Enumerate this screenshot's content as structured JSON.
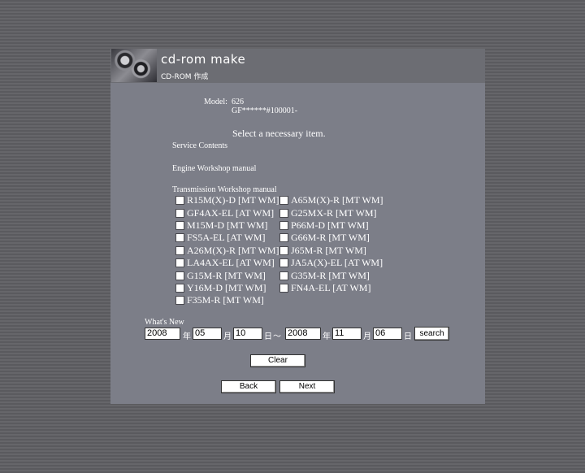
{
  "header": {
    "title": "cd-rom make",
    "subtitle": "CD-ROM 作成"
  },
  "model": {
    "label": "Model:",
    "value": "626",
    "range": "GF******#100001-"
  },
  "instruction": "Select a necessary item.",
  "sections": {
    "service": "Service Contents",
    "engine": "Engine Workshop manual",
    "transmission": "Transmission Workshop manual"
  },
  "items": [
    "R15M(X)-D [MT WM]",
    "A65M(X)-R [MT WM]",
    "GF4AX-EL [AT WM]",
    "G25MX-R [MT WM]",
    "M15M-D [MT WM]",
    "P66M-D [MT WM]",
    "FS5A-EL [AT WM]",
    "G66M-R [MT WM]",
    "A26M(X)-R [MT WM]",
    "J65M-R [MT WM]",
    "LA4AX-EL [AT WM]",
    "JA5A(X)-EL [AT WM]",
    "G15M-R [MT WM]",
    "G35M-R [MT WM]",
    "Y16M-D [MT WM]",
    "FN4A-EL [AT WM]",
    "F35M-R [MT WM]"
  ],
  "whats_new": {
    "label": "What's New",
    "from": {
      "year": "2008",
      "month": "05",
      "day": "10"
    },
    "to": {
      "year": "2008",
      "month": "11",
      "day": "06"
    },
    "year_unit": "年",
    "month_unit": "月",
    "day_unit": "日",
    "separator": "～",
    "search_label": "search"
  },
  "buttons": {
    "clear": "Clear",
    "back": "Back",
    "next": "Next"
  }
}
